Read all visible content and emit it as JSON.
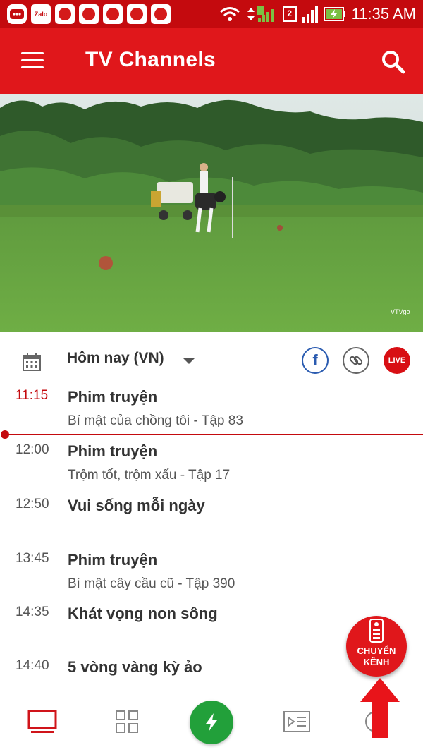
{
  "status_bar": {
    "time": "11:35 AM",
    "zalo_label": "Zalo",
    "sim2_label": "2"
  },
  "app_bar": {
    "title": "TV Channels"
  },
  "video": {
    "watermark": "VTVgo"
  },
  "date_selector": {
    "label": "Hôm nay (VN)"
  },
  "social": {
    "facebook_glyph": "f",
    "live_label": "LIVE"
  },
  "schedule": [
    {
      "time": "11:15",
      "title": "Phim truyện",
      "subtitle": "Bí mật của chồng tôi - Tập 83",
      "current": true
    },
    {
      "time": "12:00",
      "title": "Phim truyện",
      "subtitle": "Trộm tốt, trộm xấu - Tập 17"
    },
    {
      "time": "12:50",
      "title": "Vui sống mỗi ngày",
      "subtitle": ""
    },
    {
      "time": "13:45",
      "title": "Phim truyện",
      "subtitle": "Bí mật cây cầu cũ - Tập 390"
    },
    {
      "time": "14:35",
      "title": "Khát vọng non sông",
      "subtitle": ""
    },
    {
      "time": "14:40",
      "title": "5 vòng vàng kỳ ảo",
      "subtitle": ""
    }
  ],
  "fab": {
    "line1": "CHUYỂN",
    "line2": "KÊNH"
  },
  "colors": {
    "primary": "#e0171b",
    "status_bar": "#c40a0e",
    "lightning": "#22a03a",
    "facebook": "#2a5bb0"
  }
}
